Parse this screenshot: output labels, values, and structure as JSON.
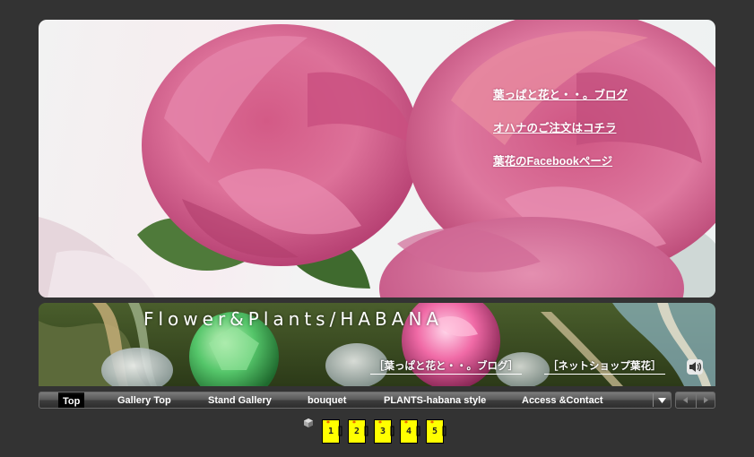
{
  "hero": {
    "links": [
      {
        "label": "葉っぱと花と・・。ブログ"
      },
      {
        "label": "オハナのご注文はコチラ"
      },
      {
        "label": "葉花のFacebookページ"
      }
    ]
  },
  "banner": {
    "title": "Flower&Plants/HABANA",
    "links": [
      {
        "label": "［葉っぱと花と・・。ブログ］"
      },
      {
        "label": "［ネットショップ葉花］"
      }
    ],
    "sound_icon": "speaker-icon"
  },
  "nav": {
    "items": [
      {
        "label": "Top",
        "active": true
      },
      {
        "label": "Gallery Top"
      },
      {
        "label": "Stand Gallery"
      },
      {
        "label": "bouquet"
      },
      {
        "label": "PLANTS-habana style"
      },
      {
        "label": "Access &Contact"
      }
    ],
    "dropdown_icon": "triangle-down-icon",
    "prev_icon": "arrow-left-icon",
    "next_icon": "arrow-right-icon"
  },
  "pages": {
    "icon": "cube-icon",
    "items": [
      {
        "label": "1"
      },
      {
        "label": "2"
      },
      {
        "label": "3"
      },
      {
        "label": "4"
      },
      {
        "label": "5"
      }
    ]
  },
  "colors": {
    "background": "#333333",
    "nav_active": "#000000",
    "page_icon": "#ffff00"
  }
}
